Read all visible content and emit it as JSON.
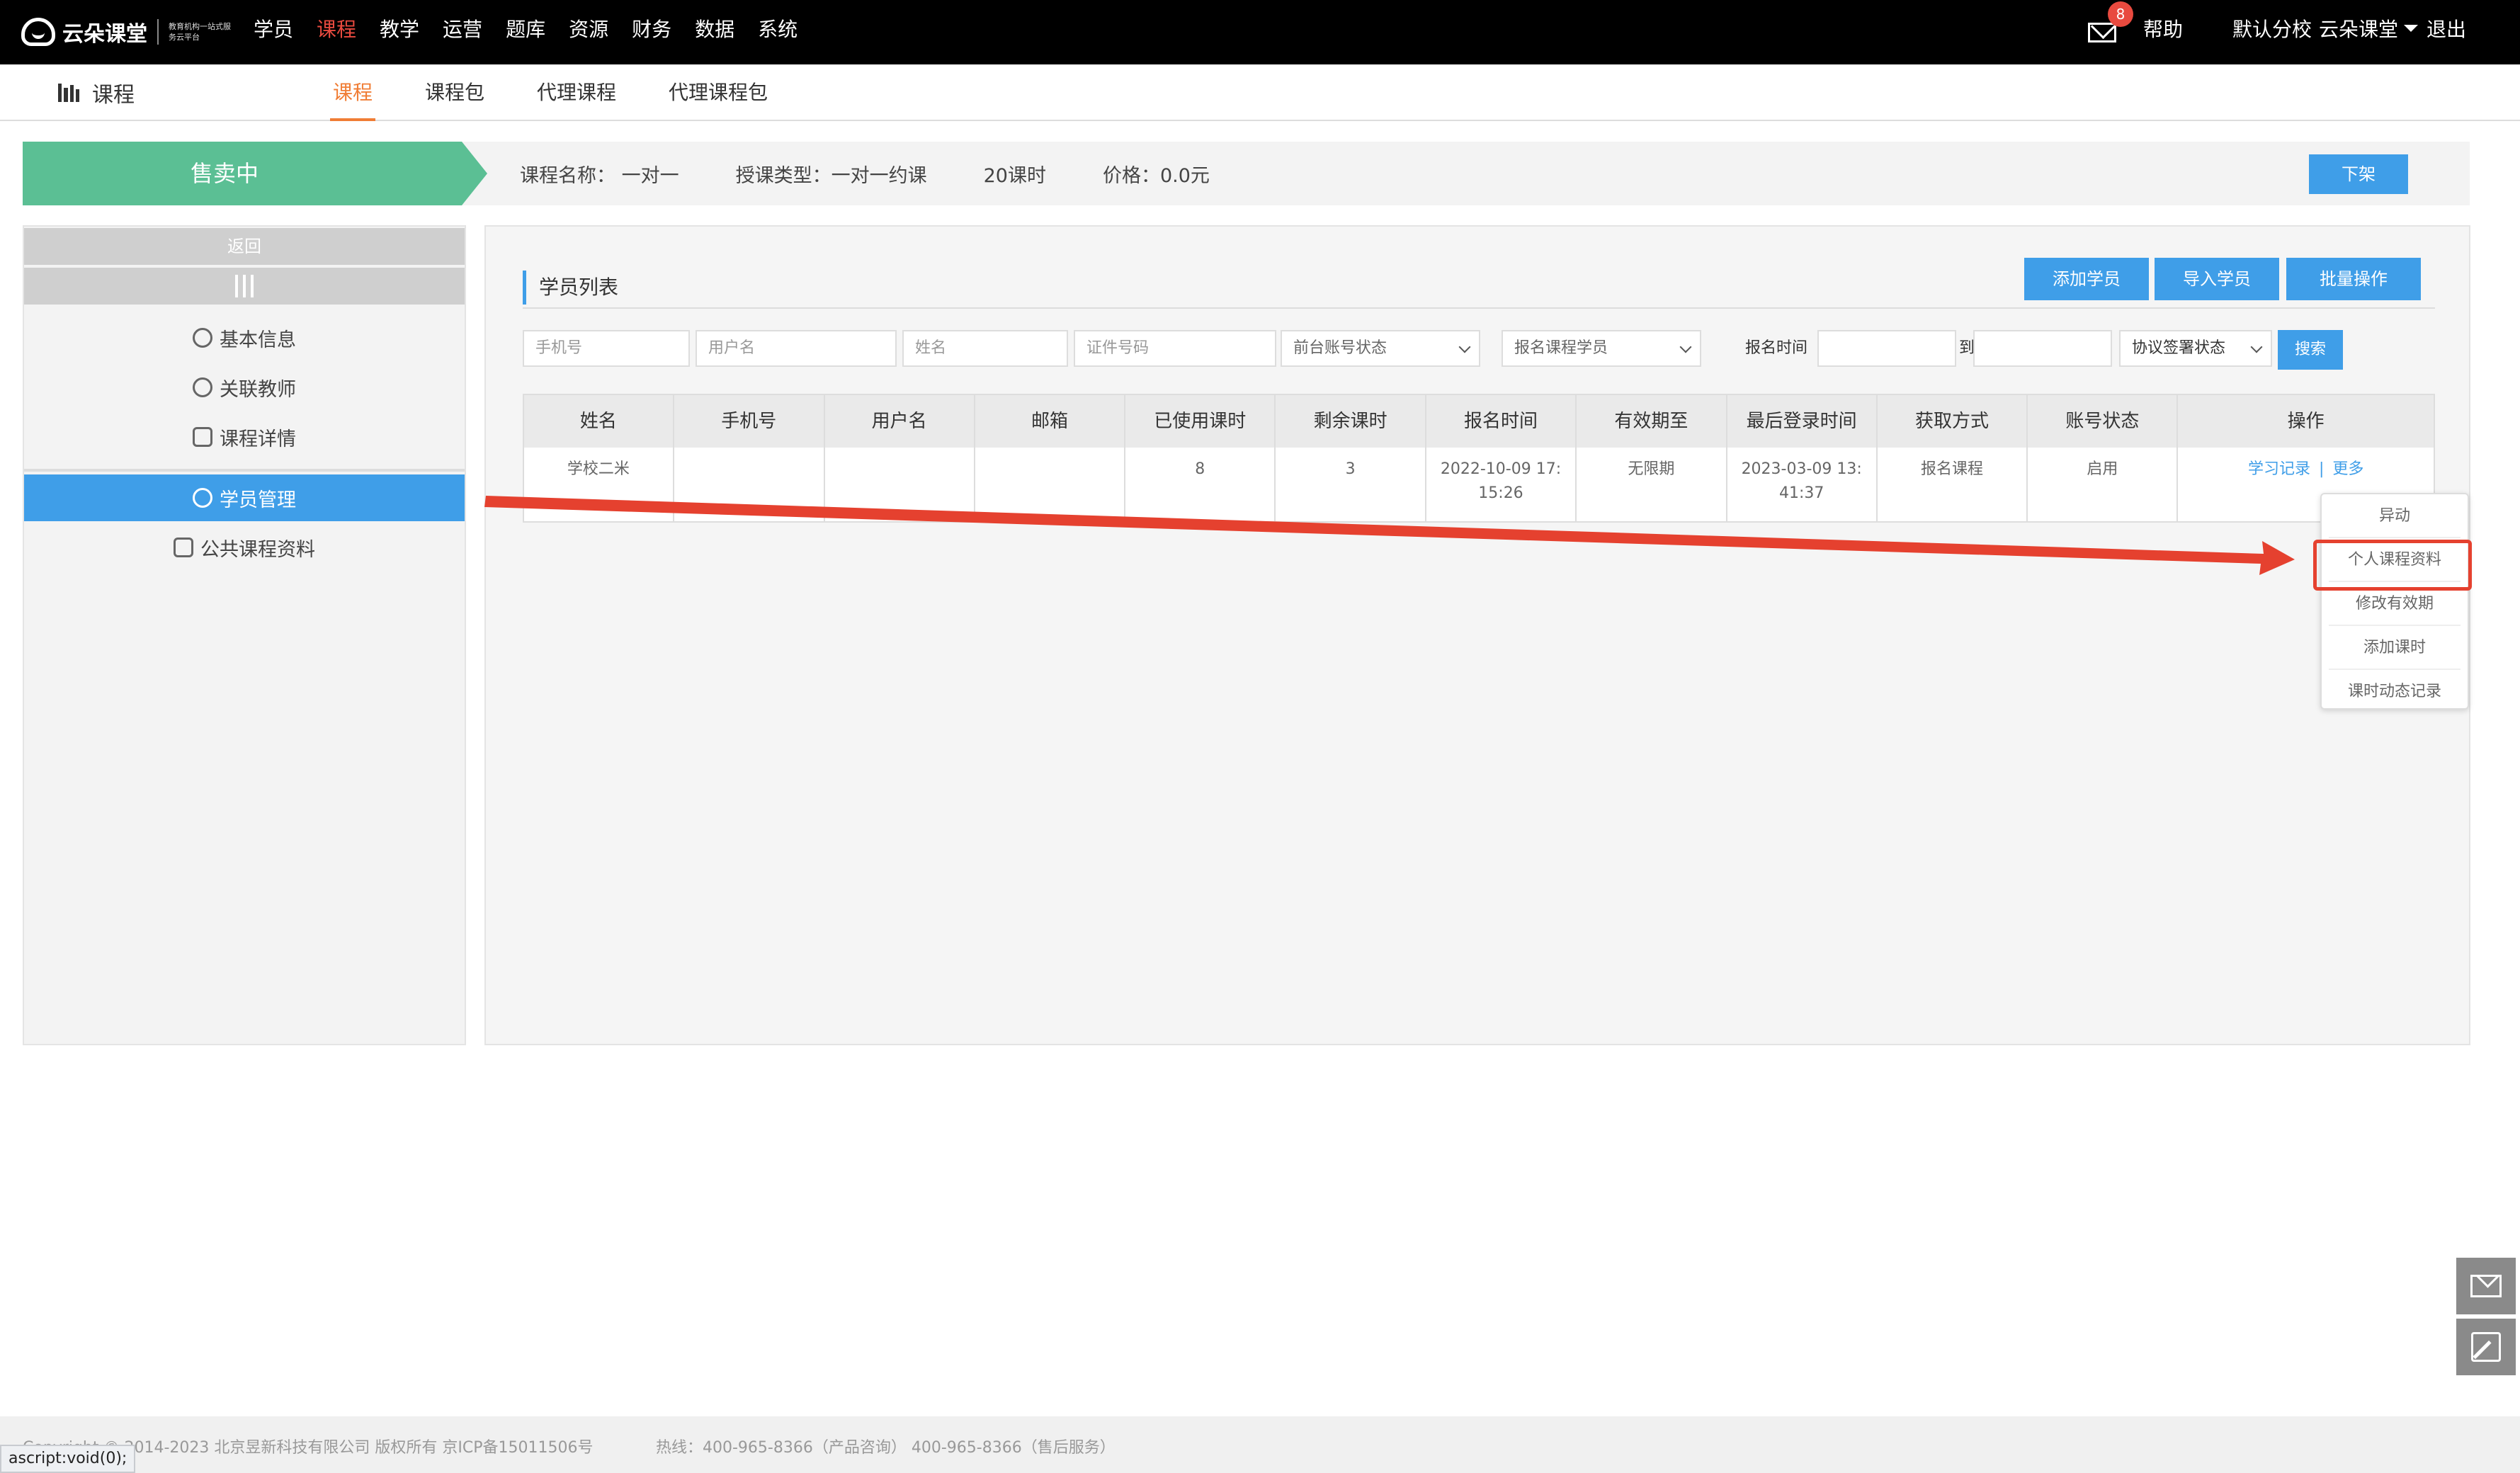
{
  "app": {
    "logo_text": "云朵课堂",
    "logo_slogan": "教育机构一站式服务云平台"
  },
  "topnav": {
    "items": [
      "学员",
      "课程",
      "教学",
      "运营",
      "题库",
      "资源",
      "财务",
      "数据",
      "系统"
    ],
    "active": "课程"
  },
  "topright": {
    "mail_badge": "8",
    "help": "帮助",
    "branch": "默认分校",
    "school": "云朵课堂",
    "logout": "退出"
  },
  "subbar": {
    "module": "课程",
    "tabs": [
      "课程",
      "课程包",
      "代理课程",
      "代理课程包"
    ]
  },
  "course": {
    "status": "售卖中",
    "name": "课程名称： 一对一",
    "type": "授课类型：一对一约课",
    "hours": "20课时",
    "price": "价格：0.0元",
    "offline_button": "下架"
  },
  "sidebar": {
    "back": "返回",
    "items": [
      "基本信息",
      "关联教师",
      "课程详情",
      "学员管理",
      "公共课程资料"
    ],
    "active": "学员管理"
  },
  "student_list": {
    "title": "学员列表",
    "buttons": {
      "add": "添加学员",
      "import": "导入学员",
      "batch": "批量操作"
    },
    "filters": {
      "phone_placeholder": "手机号",
      "username_placeholder": "用户名",
      "name_placeholder": "姓名",
      "id_placeholder": "证件号码",
      "account_status": "前台账号状态",
      "enroll_source": "报名课程学员",
      "enroll_time_label": "报名时间",
      "to_label": "到",
      "agreement_status": "协议签署状态",
      "search": "搜索"
    },
    "columns": [
      "姓名",
      "手机号",
      "用户名",
      "邮箱",
      "已使用课时",
      "剩余课时",
      "报名时间",
      "有效期至",
      "最后登录时间",
      "获取方式",
      "账号状态",
      "操作"
    ],
    "rows": [
      {
        "name": "学校二米",
        "phone": "",
        "username": "",
        "email": "",
        "used_hours": "8",
        "remaining_hours": "3",
        "enroll_time": "2022-10-09 17:15:26",
        "valid_until": "无限期",
        "last_login": "2023-03-09 13:41:37",
        "source": "报名课程",
        "status": "启用",
        "op_study": "学习记录",
        "op_more": "更多"
      }
    ],
    "more_menu": [
      "异动",
      "个人课程资料",
      "修改有效期",
      "添加课时",
      "课时动态记录"
    ]
  },
  "footer": {
    "copyright": "Copyright © 2014-2023 北京昱新科技有限公司 版权所有 京ICP备15011506号",
    "hotline": "热线：400-965-8366（产品咨询） 400-965-8366（售后服务）",
    "status_url": "ascript:void(0);"
  },
  "colors": {
    "topbar": "#000000",
    "active_nav": "#e84a3f",
    "accent_blue": "#3f9ee8",
    "status_green": "#5bbf94",
    "annotation_red": "#e5412f"
  }
}
